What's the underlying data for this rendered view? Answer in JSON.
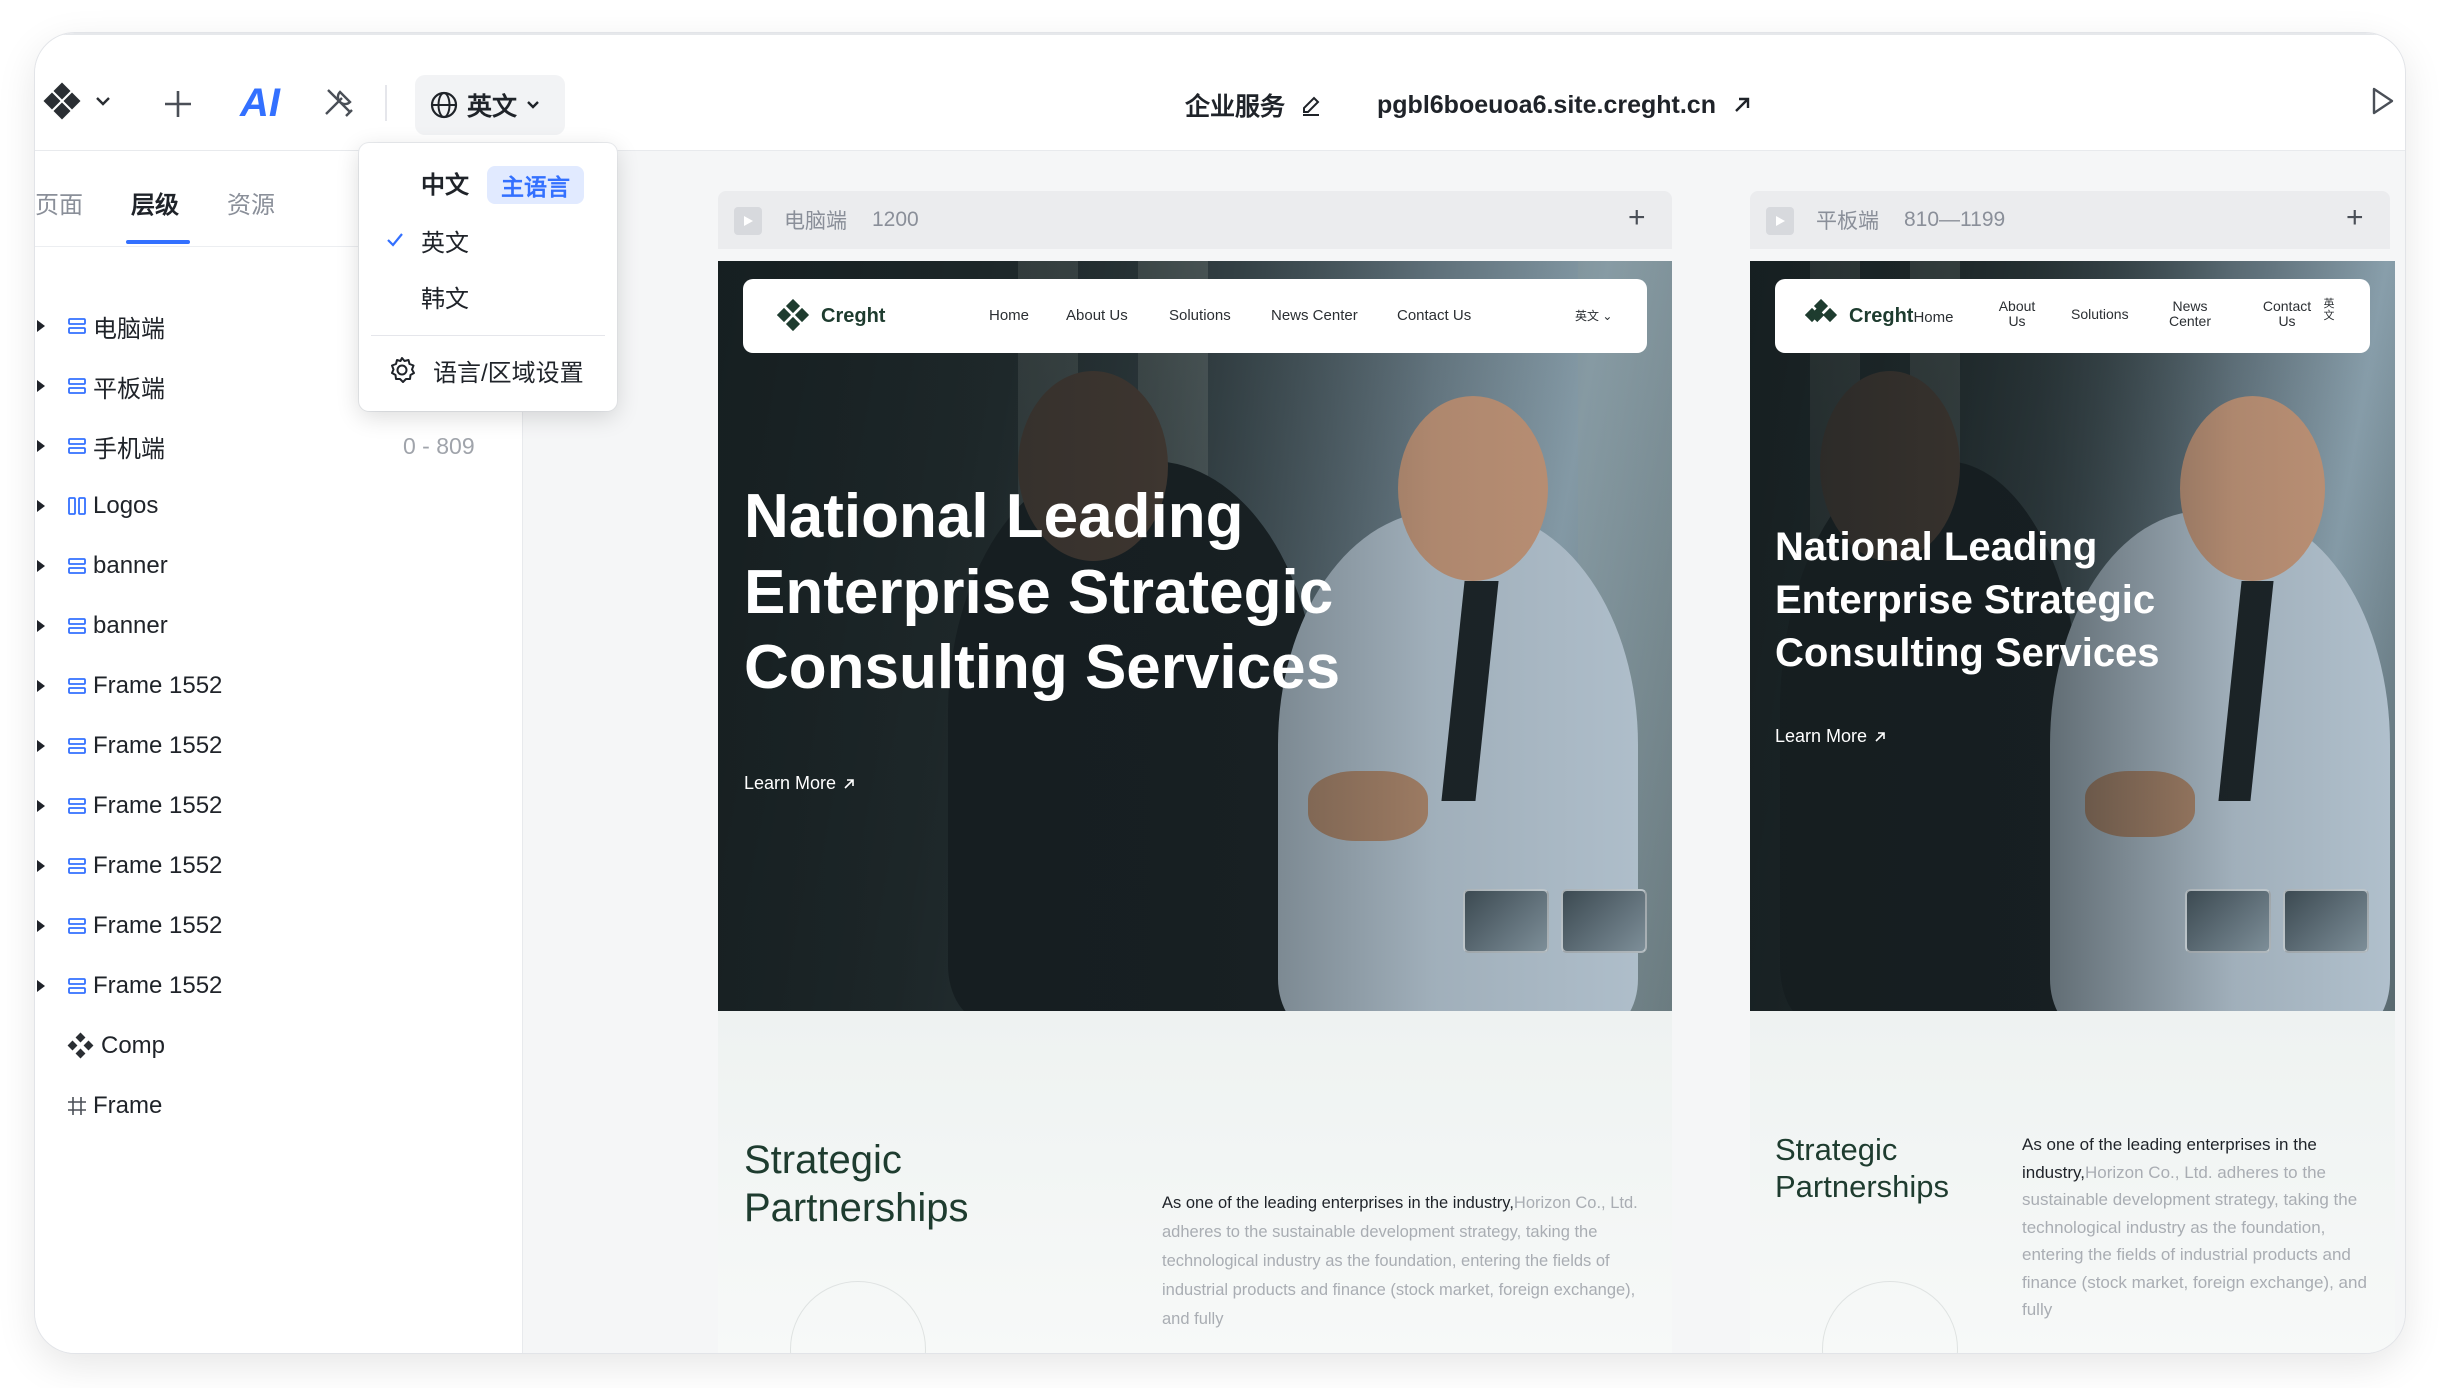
{
  "toolbar": {
    "ai_label": "AI",
    "language_button": "英文",
    "site_name": "企业服务",
    "site_url": "pgbl6boeuoa6.site.creght.cn"
  },
  "sidebar": {
    "tabs": [
      "页面",
      "层级",
      "资源"
    ],
    "active_tab": "层级",
    "layers": [
      {
        "label": "电脑端",
        "range": "",
        "icon": "stack-icon",
        "expandable": true
      },
      {
        "label": "平板端",
        "range": "",
        "icon": "stack-icon",
        "expandable": true
      },
      {
        "label": "手机端",
        "range": "0 - 809",
        "icon": "stack-icon",
        "expandable": true
      },
      {
        "label": "Logos",
        "range": "",
        "icon": "columns-icon",
        "expandable": true
      },
      {
        "label": "banner",
        "range": "",
        "icon": "stack-icon",
        "expandable": true
      },
      {
        "label": "banner",
        "range": "",
        "icon": "stack-icon",
        "expandable": true
      },
      {
        "label": "Frame 1552",
        "range": "",
        "icon": "stack-icon",
        "expandable": true
      },
      {
        "label": "Frame 1552",
        "range": "",
        "icon": "stack-icon",
        "expandable": true
      },
      {
        "label": "Frame 1552",
        "range": "",
        "icon": "stack-icon",
        "expandable": true
      },
      {
        "label": "Frame 1552",
        "range": "",
        "icon": "stack-icon",
        "expandable": true
      },
      {
        "label": "Frame 1552",
        "range": "",
        "icon": "stack-icon",
        "expandable": true
      },
      {
        "label": "Frame 1552",
        "range": "",
        "icon": "stack-icon",
        "expandable": true
      },
      {
        "label": "Comp",
        "range": "",
        "icon": "component-icon",
        "expandable": false
      },
      {
        "label": "Frame",
        "range": "",
        "icon": "frame-icon",
        "expandable": false
      }
    ]
  },
  "language_menu": {
    "primary": "中文",
    "primary_badge": "主语言",
    "options": [
      "英文",
      "韩文"
    ],
    "selected": "英文",
    "settings": "语言/区域设置"
  },
  "frames": {
    "desktop": {
      "device": "电脑端",
      "width": "1200"
    },
    "tablet": {
      "device": "平板端",
      "width": "810—1199"
    }
  },
  "site": {
    "brand": "Creght",
    "brand_home": "Home",
    "nav_desktop": [
      "Home",
      "About Us",
      "Solutions",
      "News Center",
      "Contact Us"
    ],
    "nav_tablet": [
      "About Us",
      "Solutions",
      "News Center",
      "Contact Us"
    ],
    "lang_switch": "英文",
    "hero_title_lines": [
      "National Leading",
      "Enterprise Strategic",
      "Consulting Services"
    ],
    "learn_more": "Learn More",
    "section_title_lines": [
      "Strategic",
      "Partnerships"
    ],
    "section_intro": "As one of the leading enterprises in the industry,",
    "section_body": "Horizon Co., Ltd. adheres to the sustainable development strategy, taking the technological industry as the foundation, entering the fields of industrial products and finance (stock market, foreign exchange), and fully"
  },
  "colors": {
    "accent": "#3370ff",
    "brand_green": "#1e3c2f",
    "badge_bg": "#e1eaff"
  }
}
